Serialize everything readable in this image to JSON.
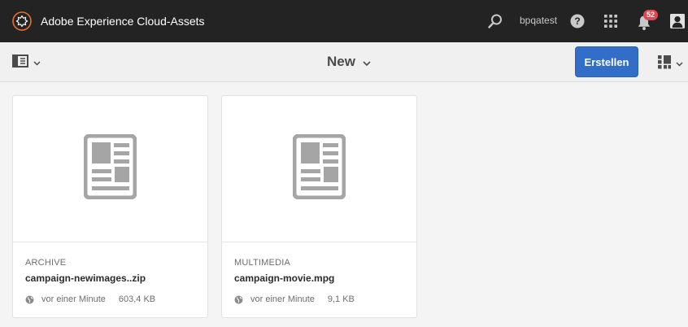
{
  "shell": {
    "app_title": "Adobe Experience Cloud-Assets",
    "user_name": "bpqatest",
    "notification_count": "52",
    "icons": [
      "adobe-experience-cloud-logo",
      "search-icon",
      "help-icon",
      "solutions-grid-icon",
      "bell-icon",
      "user-icon"
    ]
  },
  "actionbar": {
    "title": "New",
    "create_label": "Erstellen",
    "icons": [
      "rail-toggle-icon",
      "chevron-down-icon",
      "card-view-icon"
    ]
  },
  "cards": [
    {
      "type": "ARCHIVE",
      "name": "campaign-newimages..zip",
      "modified": "vor einer Minute",
      "size": "603,4 KB",
      "thumbnail_icon": "document-icon"
    },
    {
      "type": "MULTIMEDIA",
      "name": "campaign-movie.mpg",
      "modified": "vor einer Minute",
      "size": "9,1 KB",
      "thumbnail_icon": "document-icon"
    }
  ],
  "colors": {
    "shell_bg": "#232323",
    "accent": "#326ec8",
    "badge": "#e34850",
    "background": "#f4f4f4"
  }
}
